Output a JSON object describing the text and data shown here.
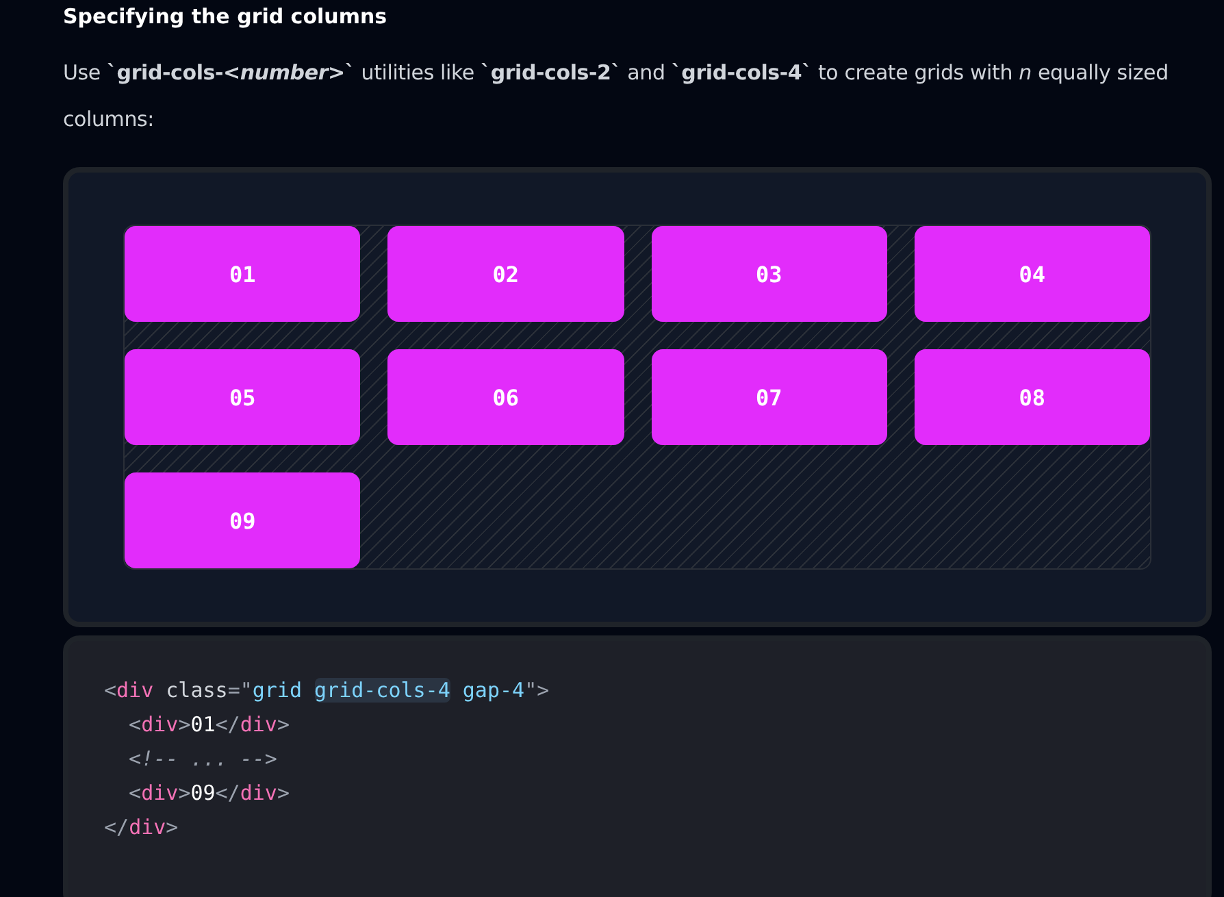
{
  "heading": "Specifying the grid columns",
  "intro": "Use **`grid-cols-*<number>*`** utilities like **`grid-cols-2`** and **`grid-cols-4`** to create grids with *n* equally sized columns:",
  "grid_items": [
    "01",
    "02",
    "03",
    "04",
    "05",
    "06",
    "07",
    "08",
    "09"
  ],
  "code_lines": [
    [
      {
        "kind": "punct",
        "text": "<"
      },
      {
        "kind": "tag",
        "text": "div"
      },
      {
        "kind": "attr",
        "text": " class"
      },
      {
        "kind": "punct",
        "text": "=\""
      },
      {
        "kind": "string",
        "text": "grid "
      },
      {
        "kind": "highlight",
        "text": "grid-cols-4"
      },
      {
        "kind": "string",
        "text": " gap-4"
      },
      {
        "kind": "punct",
        "text": "\">"
      }
    ],
    [
      {
        "kind": "punct",
        "text": "  <"
      },
      {
        "kind": "tag",
        "text": "div"
      },
      {
        "kind": "punct",
        "text": ">"
      },
      {
        "kind": "text",
        "text": "01"
      },
      {
        "kind": "punct",
        "text": "</"
      },
      {
        "kind": "tag",
        "text": "div"
      },
      {
        "kind": "punct",
        "text": ">"
      }
    ],
    [
      {
        "kind": "comment",
        "text": "  <!-- ... -->"
      }
    ],
    [
      {
        "kind": "punct",
        "text": "  <"
      },
      {
        "kind": "tag",
        "text": "div"
      },
      {
        "kind": "punct",
        "text": ">"
      },
      {
        "kind": "text",
        "text": "09"
      },
      {
        "kind": "punct",
        "text": "</"
      },
      {
        "kind": "tag",
        "text": "div"
      },
      {
        "kind": "punct",
        "text": ">"
      }
    ],
    [
      {
        "kind": "punct",
        "text": "</"
      },
      {
        "kind": "tag",
        "text": "div"
      },
      {
        "kind": "punct",
        "text": ">"
      }
    ]
  ]
}
